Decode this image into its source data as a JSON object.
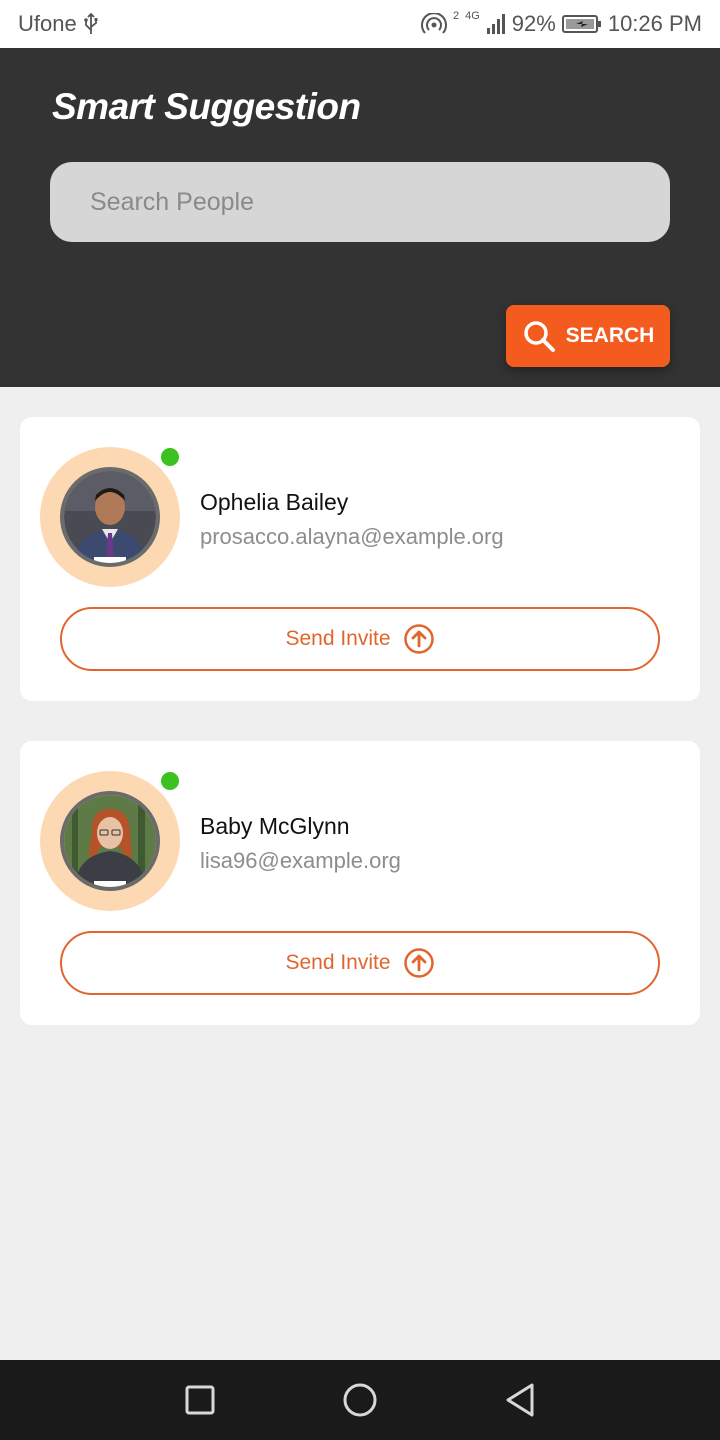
{
  "status_bar": {
    "carrier": "Ufone",
    "network": "4G",
    "sim": "2",
    "battery": "92%",
    "time": "10:26 PM",
    "icons": [
      "usb-icon",
      "hotspot-icon",
      "signal-icon",
      "battery-charging-icon"
    ]
  },
  "header": {
    "title": "Smart Suggestion",
    "search_placeholder": "Search People",
    "search_value": "",
    "search_button_label": "SEARCH",
    "search_icon": "search-icon"
  },
  "suggestions": [
    {
      "name": "Ophelia Bailey",
      "email": "prosacco.alayna@example.org",
      "online": true,
      "invite_label": "Send Invite",
      "invite_icon": "upload-circle-icon"
    },
    {
      "name": "Baby McGlynn",
      "email": "lisa96@example.org",
      "online": true,
      "invite_label": "Send Invite",
      "invite_icon": "upload-circle-icon"
    }
  ],
  "nav_bar": {
    "buttons": [
      "recent-apps-icon",
      "home-icon",
      "back-icon"
    ]
  },
  "colors": {
    "header_bg": "#333333",
    "accent": "#f45c1f",
    "invite_accent": "#e0662e",
    "online": "#3cc21e",
    "avatar_ring": "#fdd9b3",
    "page_bg": "#efefef"
  }
}
